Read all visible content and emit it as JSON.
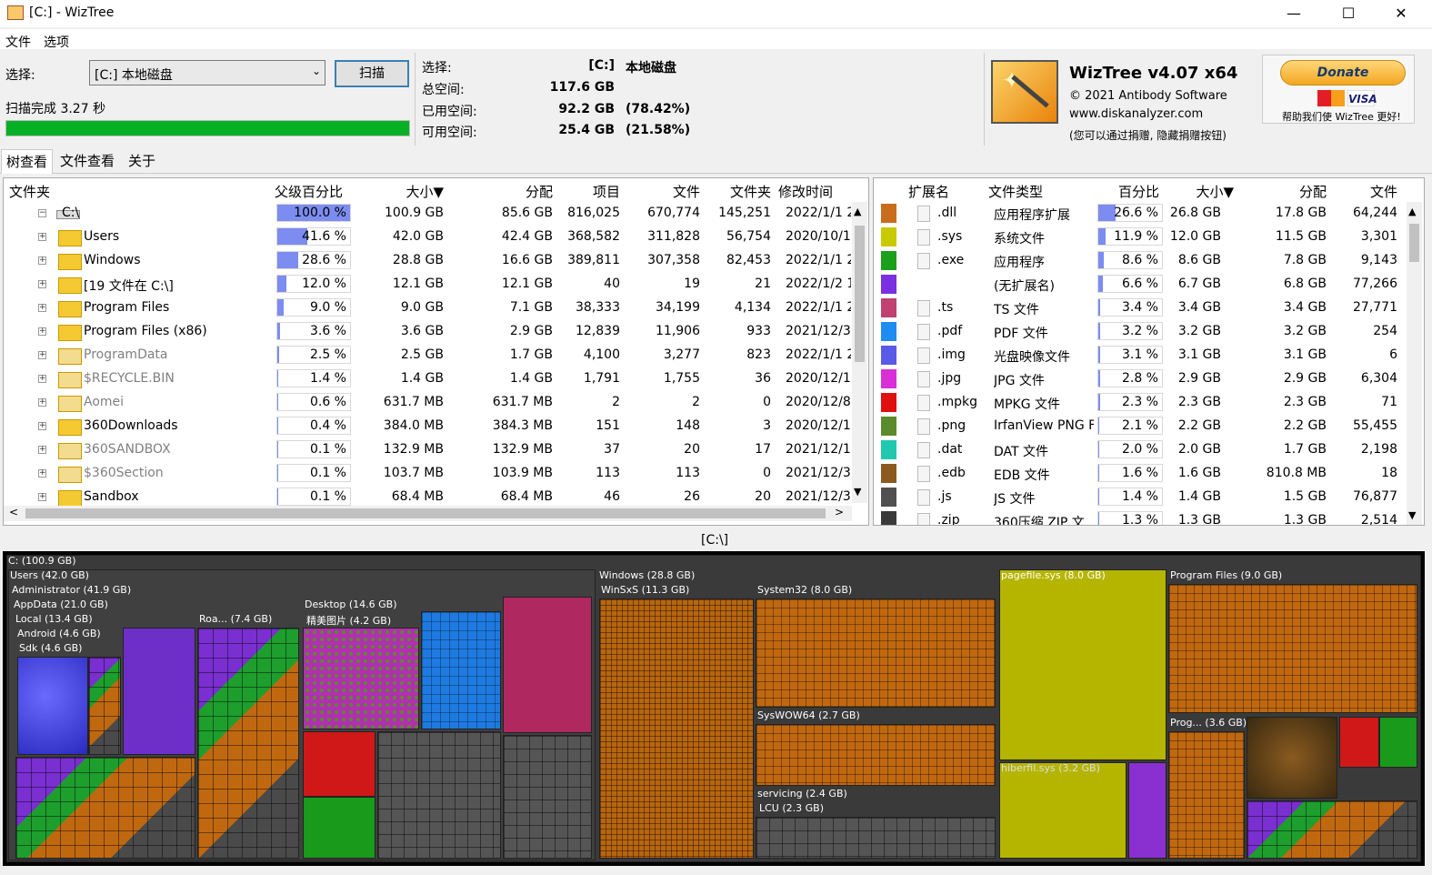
{
  "window": {
    "title": "[C:]  - WizTree",
    "minimize": "—",
    "maximize": "☐",
    "close": "✕"
  },
  "menu": [
    "文件",
    "选项"
  ],
  "scan": {
    "select_label": "选择:",
    "drive_value": "[C:] 本地磁盘",
    "scan_button": "扫描",
    "status": "扫描完成 3.27 秒",
    "progress_percent": 100
  },
  "drive_info": {
    "rows": [
      {
        "label": "选择:",
        "value": "[C:]",
        "extra": "本地磁盘"
      },
      {
        "label": "总空间:",
        "value": "117.6 GB",
        "extra": ""
      },
      {
        "label": "已用空间:",
        "value": "92.2 GB",
        "extra": "(78.42%)"
      },
      {
        "label": "可用空间:",
        "value": "25.4 GB",
        "extra": "(21.58%)"
      }
    ]
  },
  "brand": {
    "name": "WizTree v4.07 x64",
    "copyright": "© 2021 Antibody Software",
    "url": "www.diskanalyzer.com",
    "note": "(您可以通过捐赠, 隐藏捐赠按钮)",
    "donate": "Donate",
    "visa": "VISA",
    "donate_caption": "帮助我们使 WizTree 更好!"
  },
  "tabs": [
    "树查看",
    "文件查看",
    "关于"
  ],
  "tree": {
    "headers": [
      "文件夹",
      "父级百分比",
      "大小▼",
      "分配",
      "项目",
      "文件",
      "文件夹",
      "修改时间"
    ],
    "rows": [
      {
        "expander": "−",
        "icon": "drive",
        "name": "C:\\",
        "pct": "100.0 %",
        "pct_value": 100,
        "size": "100.9 GB",
        "alloc": "85.6 GB",
        "items": "816,025",
        "files": "670,774",
        "folders": "145,251",
        "modified": "2022/1/1 2"
      },
      {
        "expander": "+",
        "icon": "folder",
        "name": "Users",
        "pct": "41.6 %",
        "pct_value": 41.6,
        "size": "42.0 GB",
        "alloc": "42.4 GB",
        "items": "368,582",
        "files": "311,828",
        "folders": "56,754",
        "modified": "2020/10/1"
      },
      {
        "expander": "+",
        "icon": "folder",
        "name": "Windows",
        "pct": "28.6 %",
        "pct_value": 28.6,
        "size": "28.8 GB",
        "alloc": "16.6 GB",
        "items": "389,811",
        "files": "307,358",
        "folders": "82,453",
        "modified": "2022/1/1 2"
      },
      {
        "expander": "+",
        "icon": "folder",
        "name": "[19 文件在 C:\\]",
        "pct": "12.0 %",
        "pct_value": 12,
        "size": "12.1 GB",
        "alloc": "12.1 GB",
        "items": "40",
        "files": "19",
        "folders": "21",
        "modified": "2022/1/2 1"
      },
      {
        "expander": "+",
        "icon": "folder",
        "name": "Program Files",
        "pct": "9.0 %",
        "pct_value": 9,
        "size": "9.0 GB",
        "alloc": "7.1 GB",
        "items": "38,333",
        "files": "34,199",
        "folders": "4,134",
        "modified": "2022/1/1 2"
      },
      {
        "expander": "+",
        "icon": "folder",
        "name": "Program Files (x86)",
        "pct": "3.6 %",
        "pct_value": 3.6,
        "size": "3.6 GB",
        "alloc": "2.9 GB",
        "items": "12,839",
        "files": "11,906",
        "folders": "933",
        "modified": "2021/12/3"
      },
      {
        "expander": "+",
        "icon": "folder-hidden",
        "name": "ProgramData",
        "pct": "2.5 %",
        "pct_value": 2.5,
        "size": "2.5 GB",
        "alloc": "1.7 GB",
        "items": "4,100",
        "files": "3,277",
        "folders": "823",
        "modified": "2022/1/1 2"
      },
      {
        "expander": "+",
        "icon": "folder-system",
        "name": "$RECYCLE.BIN",
        "pct": "1.4 %",
        "pct_value": 1.4,
        "size": "1.4 GB",
        "alloc": "1.4 GB",
        "items": "1,791",
        "files": "1,755",
        "folders": "36",
        "modified": "2020/12/1"
      },
      {
        "expander": "+",
        "icon": "folder-hidden",
        "name": "Aomei",
        "pct": "0.6 %",
        "pct_value": 0.6,
        "size": "631.7 MB",
        "alloc": "631.7 MB",
        "items": "2",
        "files": "2",
        "folders": "0",
        "modified": "2020/12/8"
      },
      {
        "expander": "+",
        "icon": "folder",
        "name": "360Downloads",
        "pct": "0.4 %",
        "pct_value": 0.4,
        "size": "384.0 MB",
        "alloc": "384.3 MB",
        "items": "151",
        "files": "148",
        "folders": "3",
        "modified": "2020/12/1"
      },
      {
        "expander": "+",
        "icon": "folder-system",
        "name": "360SANDBOX",
        "pct": "0.1 %",
        "pct_value": 0.1,
        "size": "132.9 MB",
        "alloc": "132.9 MB",
        "items": "37",
        "files": "20",
        "folders": "17",
        "modified": "2021/12/1"
      },
      {
        "expander": "+",
        "icon": "folder-system",
        "name": "$360Section",
        "pct": "0.1 %",
        "pct_value": 0.1,
        "size": "103.7 MB",
        "alloc": "103.9 MB",
        "items": "113",
        "files": "113",
        "folders": "0",
        "modified": "2021/12/3"
      },
      {
        "expander": "+",
        "icon": "folder",
        "name": "Sandbox",
        "pct": "0.1 %",
        "pct_value": 0.1,
        "size": "68.4 MB",
        "alloc": "68.4 MB",
        "items": "46",
        "files": "26",
        "folders": "20",
        "modified": "2021/12/3"
      }
    ]
  },
  "ext": {
    "headers": [
      "扩展名",
      "文件类型",
      "百分比",
      "大小▼",
      "分配",
      "文件"
    ],
    "rows": [
      {
        "color": "#c96d1c",
        "ext": ".dll",
        "type": "应用程序扩展",
        "pct": "26.6 %",
        "pct_value": 26.6,
        "size": "26.8 GB",
        "alloc": "17.8 GB",
        "files": "64,244"
      },
      {
        "color": "#c9c900",
        "ext": ".sys",
        "type": "系统文件",
        "pct": "11.9 %",
        "pct_value": 11.9,
        "size": "12.0 GB",
        "alloc": "11.5 GB",
        "files": "3,301"
      },
      {
        "color": "#1aa01a",
        "ext": ".exe",
        "type": "应用程序",
        "pct": "8.6 %",
        "pct_value": 8.6,
        "size": "8.6 GB",
        "alloc": "7.8 GB",
        "files": "9,143"
      },
      {
        "color": "#7a2fe0",
        "ext": "",
        "type": "(无扩展名)",
        "pct": "6.6 %",
        "pct_value": 6.6,
        "size": "6.7 GB",
        "alloc": "6.8 GB",
        "files": "77,266"
      },
      {
        "color": "#c04070",
        "ext": ".ts",
        "type": "TS 文件",
        "pct": "3.4 %",
        "pct_value": 3.4,
        "size": "3.4 GB",
        "alloc": "3.4 GB",
        "files": "27,771"
      },
      {
        "color": "#1e8cf0",
        "ext": ".pdf",
        "type": "PDF 文件",
        "pct": "3.2 %",
        "pct_value": 3.2,
        "size": "3.2 GB",
        "alloc": "3.2 GB",
        "files": "254"
      },
      {
        "color": "#5a5ae8",
        "ext": ".img",
        "type": "光盘映像文件",
        "pct": "3.1 %",
        "pct_value": 3.1,
        "size": "3.1 GB",
        "alloc": "3.1 GB",
        "files": "6"
      },
      {
        "color": "#d82fd8",
        "ext": ".jpg",
        "type": "JPG 文件",
        "pct": "2.8 %",
        "pct_value": 2.8,
        "size": "2.9 GB",
        "alloc": "2.9 GB",
        "files": "6,304"
      },
      {
        "color": "#e01010",
        "ext": ".mpkg",
        "type": "MPKG 文件",
        "pct": "2.3 %",
        "pct_value": 2.3,
        "size": "2.3 GB",
        "alloc": "2.3 GB",
        "files": "71"
      },
      {
        "color": "#5a8a2a",
        "ext": ".png",
        "type": "IrfanView PNG F",
        "pct": "2.1 %",
        "pct_value": 2.1,
        "size": "2.2 GB",
        "alloc": "2.2 GB",
        "files": "55,455"
      },
      {
        "color": "#20c8b0",
        "ext": ".dat",
        "type": "DAT 文件",
        "pct": "2.0 %",
        "pct_value": 2.0,
        "size": "2.0 GB",
        "alloc": "1.7 GB",
        "files": "2,198"
      },
      {
        "color": "#8a5a20",
        "ext": ".edb",
        "type": "EDB 文件",
        "pct": "1.6 %",
        "pct_value": 1.6,
        "size": "1.6 GB",
        "alloc": "810.8 MB",
        "files": "18"
      },
      {
        "color": "#505050",
        "ext": ".js",
        "type": "JS 文件",
        "pct": "1.4 %",
        "pct_value": 1.4,
        "size": "1.4 GB",
        "alloc": "1.5 GB",
        "files": "76,877"
      },
      {
        "color": "#3a3a3a",
        "ext": ".zip",
        "type": "360压缩 ZIP 文",
        "pct": "1.3 %",
        "pct_value": 1.3,
        "size": "1.3 GB",
        "alloc": "1.3 GB",
        "files": "2,514"
      }
    ]
  },
  "treemap": {
    "path": "[C:\\]",
    "labels": {
      "c": "C: (100.9 GB)",
      "users": "Users (42.0 GB)",
      "admin": "Administrator (41.9 GB)",
      "appdata": "AppData (21.0 GB)",
      "local": "Local (13.4 GB)",
      "android": "Android (4.6 GB)",
      "sdk": "Sdk (4.6 GB)",
      "roa": "Roa... (7.4 GB)",
      "desktop": "Desktop (14.6 GB)",
      "pics": "精美图片 (4.2 GB)",
      "windows": "Windows (28.8 GB)",
      "winsxs": "WinSxS (11.3 GB)",
      "system32": "System32 (8.0 GB)",
      "syswow": "SysWOW64 (2.7 GB)",
      "servicing": "servicing (2.4 GB)",
      "lcu": "LCU (2.3 GB)",
      "pagefile": "pagefile.sys (8.0 GB)",
      "hiberfil": "hiberfil.sys (3.2 GB)",
      "progfiles": "Program Files (9.0 GB)",
      "prog86": "Prog... (3.6 GB)"
    }
  }
}
